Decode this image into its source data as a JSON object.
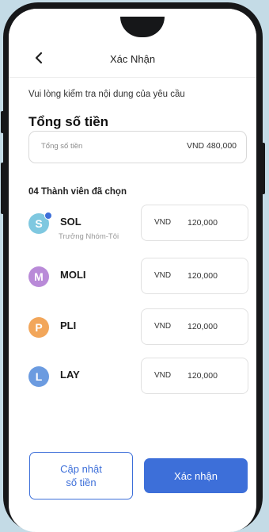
{
  "header": {
    "title": "Xác Nhận",
    "back_icon": "chevron-left-icon"
  },
  "instruction": "Vui lòng kiểm tra nội dung của yêu cầu",
  "total": {
    "title": "Tổng số tiền",
    "label": "Tổng số tiền",
    "value": "VND 480,000"
  },
  "members_header": "04 Thành viên đã chọn",
  "members": [
    {
      "name": "SOL",
      "role": "Trưởng Nhóm-Tôi",
      "avatar_color": "#7fc8e0",
      "avatar_letter": "S",
      "currency": "VND",
      "amount": "120,000"
    },
    {
      "name": "MOLI",
      "avatar_color": "#b98ad8",
      "avatar_letter": "M",
      "currency": "VND",
      "amount": "120,000"
    },
    {
      "name": "PLI",
      "avatar_color": "#f2a65a",
      "avatar_letter": "P",
      "currency": "VND",
      "amount": "120,000"
    },
    {
      "name": "LAY",
      "avatar_color": "#6b9be0",
      "avatar_letter": "L",
      "currency": "VND",
      "amount": "120,000"
    }
  ],
  "buttons": {
    "update_label": "Cập nhật\nsố tiền",
    "confirm_label": "Xác nhận"
  },
  "colors": {
    "primary": "#3d6fd9",
    "background": "#c4dbe6"
  }
}
